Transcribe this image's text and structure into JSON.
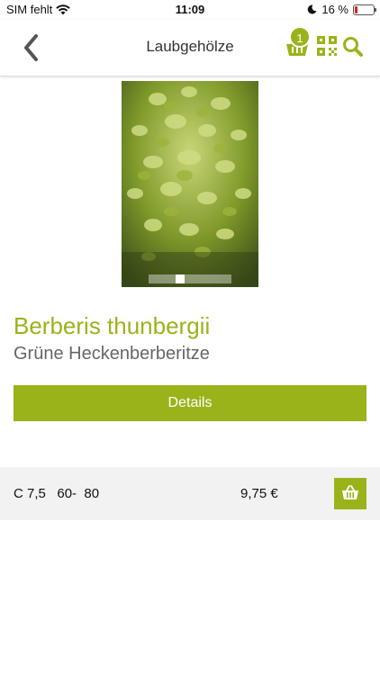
{
  "status_bar": {
    "carrier": "SIM fehlt",
    "time": "11:09",
    "battery": "16 %",
    "battery_level": 0.16,
    "battery_color": "#e02020"
  },
  "nav": {
    "title": "Laubgehölze",
    "basket_count": "1",
    "icons": [
      "back-chevron-icon",
      "basket-icon",
      "qr-code-icon",
      "search-icon"
    ]
  },
  "gallery": {
    "image_count": 2,
    "active_index": 1
  },
  "product": {
    "botanical_name": "Berberis thunbergii",
    "common_name": "Grüne Heckenberberitze",
    "details_label": "Details"
  },
  "variants": [
    {
      "size": "C 7,5   60-  80",
      "price": "9,75 €"
    }
  ],
  "colors": {
    "accent": "#9bb31a",
    "row_background": "#f2f2f2"
  }
}
